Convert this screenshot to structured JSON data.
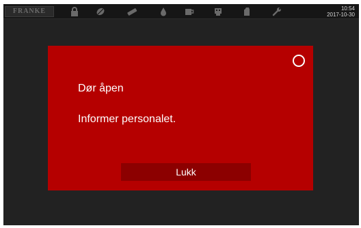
{
  "topbar": {
    "logo": "FRANKE",
    "icons": [
      "lock-icon",
      "coffee-bean-icon",
      "cleaning-tablet-icon",
      "water-drop-icon",
      "cup-icon",
      "grinder-icon",
      "milk-icon",
      "wrench-icon"
    ],
    "time": "10:54",
    "date": "2017-10-30"
  },
  "dialog": {
    "title": "Dør åpen",
    "message": "Informer personalet.",
    "close_label": "Lukk"
  },
  "colors": {
    "dialog_bg": "#b50000",
    "button_bg": "#8c0000",
    "screen_bg": "#222222"
  }
}
